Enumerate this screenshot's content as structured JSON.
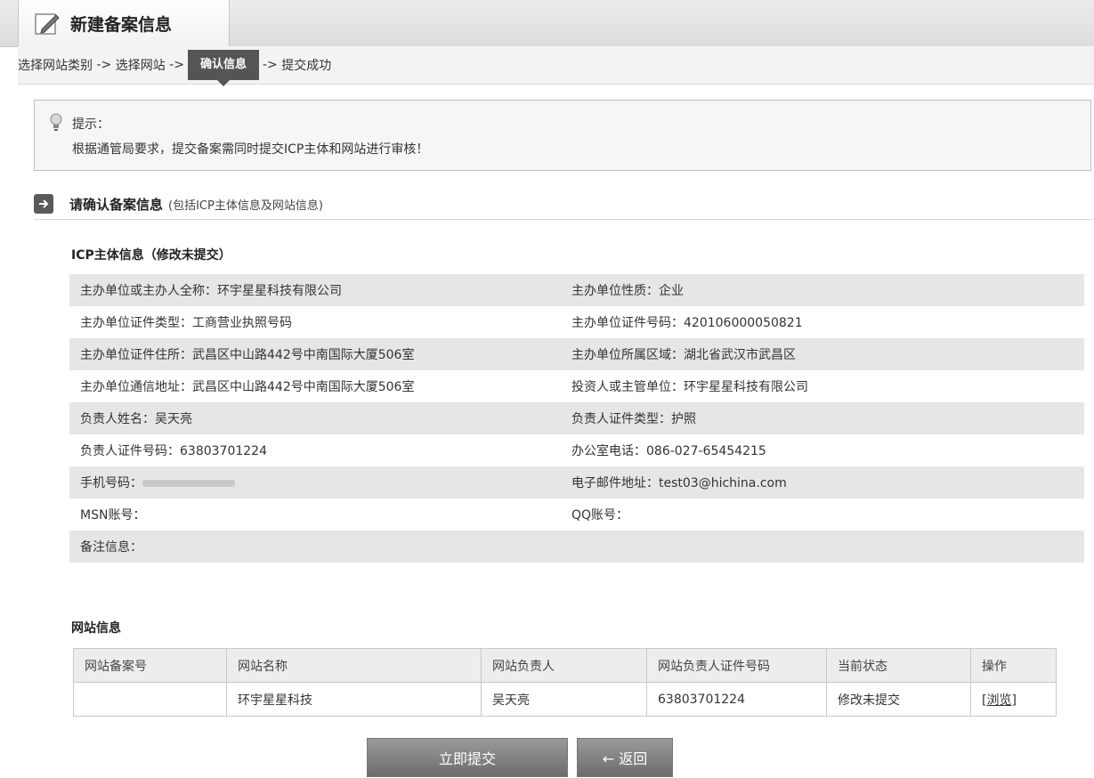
{
  "tab": {
    "title": "新建备案信息"
  },
  "steps": {
    "items": [
      "选择网站类别",
      "选择网站",
      "确认信息",
      "提交成功"
    ],
    "separator": "->"
  },
  "tip": {
    "title": "提示：",
    "text": "根据通管局要求，提交备案需同时提交ICP主体和网站进行审核！"
  },
  "section": {
    "title": "请确认备案信息",
    "note": "(包括ICP主体信息及网站信息)"
  },
  "icp": {
    "title": "ICP主体信息（修改未提交）",
    "rows": [
      {
        "left": "主办单位或主办人全称：环宇星星科技有限公司",
        "right": "主办单位性质：企业"
      },
      {
        "left": "主办单位证件类型：工商营业执照号码",
        "right": "主办单位证件号码：420106000050821"
      },
      {
        "left": "主办单位证件住所：武昌区中山路442号中南国际大厦506室",
        "right": "主办单位所属区域：湖北省武汉市武昌区"
      },
      {
        "left": "主办单位通信地址：武昌区中山路442号中南国际大厦506室",
        "right": "投资人或主管单位：环宇星星科技有限公司"
      },
      {
        "left": "负责人姓名：吴天亮",
        "right": "负责人证件类型：护照"
      },
      {
        "left": "负责人证件号码：63803701224",
        "right": "办公室电话：086-027-65454215"
      },
      {
        "left": "手机号码：",
        "right": "电子邮件地址：test03@hichina.com"
      },
      {
        "left": "MSN账号：",
        "right": "QQ账号："
      },
      {
        "left": "备注信息：",
        "right": ""
      }
    ]
  },
  "site": {
    "title": "网站信息",
    "headers": [
      "网站备案号",
      "网站名称",
      "网站负责人",
      "网站负责人证件号码",
      "当前状态",
      "操作"
    ],
    "rows": [
      {
        "record_no": "",
        "name": "环宇星星科技",
        "owner": "吴天亮",
        "owner_id": "63803701224",
        "status": "修改未提交",
        "action": "[浏览]"
      }
    ]
  },
  "buttons": {
    "submit": "立即提交",
    "back": "← 返回"
  },
  "colors": {
    "active_step": "#555555",
    "alt_row": "#e6e6e6",
    "button": "#7a7a7a"
  }
}
